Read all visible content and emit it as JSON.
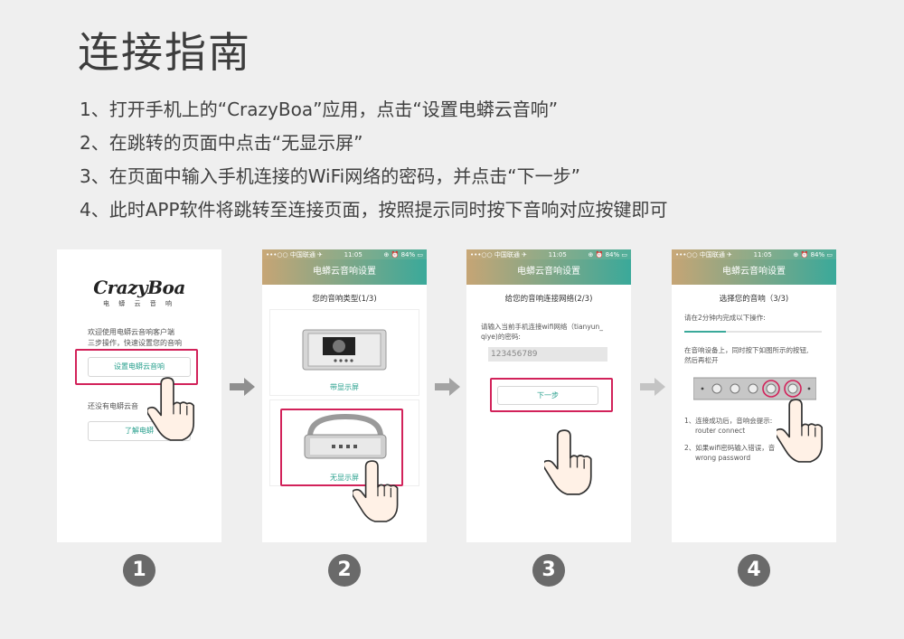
{
  "title": "连接指南",
  "steps": [
    "1、打开手机上的“CrazyBoa”应用，点击“设置电蟒云音响”",
    "2、在跳转的页面中点击“无显示屏”",
    "3、在页面中输入手机连接的WiFi网络的密码，并点击“下一步”",
    "4、此时APP软件将跳转至连接页面，按照提示同时按下音响对应按键即可"
  ],
  "status_bar": {
    "carrier": "•••○○ 中国联通 ✈",
    "time": "11:05",
    "battery": "⊕ ⏰ 84% ▭"
  },
  "screen1": {
    "logo": "CrazyBoa",
    "logo_sub": "电 蟒 云 音 响",
    "welcome_line1": "欢迎使用电蟒云音响客户端",
    "welcome_line2": "三步操作，快速设置您的音响",
    "setup_button": "设置电蟒云音响",
    "no_speaker_text": "还没有电蟒云音",
    "learn_button": "了解电蟒"
  },
  "screen2": {
    "nav_title": "电蟒云音响设置",
    "subtitle": "您的音响类型(1/3)",
    "option_display": "带显示屏",
    "option_no_display": "无显示屏"
  },
  "screen3": {
    "nav_title": "电蟒云音响设置",
    "subtitle": "给您的音响连接网络(2/3)",
    "prompt_line1": "请输入当前手机连接wifi网络（tianyun_",
    "prompt_line2": "qiye)的密码:",
    "password_value": "123456789",
    "next_button": "下一步"
  },
  "screen4": {
    "nav_title": "电蟒云音响设置",
    "subtitle": "选择您的音响（3/3)",
    "timer_text": "请在2分钟内完成以下操作:",
    "instruction_line1": "在音响设备上，同时按下如图所示的按钮,",
    "instruction_line2": "然后再松开",
    "note1_line1": "1、连接成功后，音响会提示:",
    "note1_line2": "router connect",
    "note2_line1": "2、如果wifi密码输入错误，音",
    "note2_line2": "wrong password"
  },
  "numbers": [
    "1",
    "2",
    "3",
    "4"
  ],
  "colors": {
    "accent_red": "#d2225a",
    "accent_green": "#29a08e",
    "bar_gold": "#c6a575",
    "bar_teal": "#3aa99a"
  }
}
